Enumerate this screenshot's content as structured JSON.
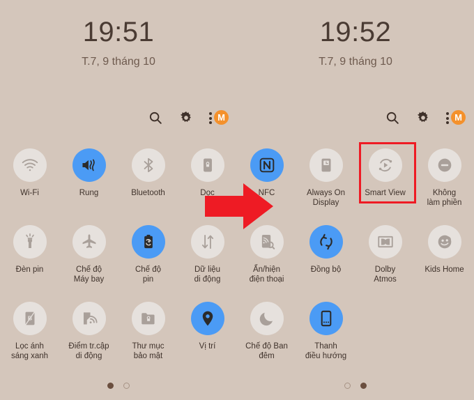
{
  "theme": {
    "background": "#d4c6bb",
    "tile_off": "#e6e1dd",
    "tile_on": "#4b9bf5",
    "accent_red": "#ee1b24",
    "badge_orange": "#f4912c",
    "text": "#3f322b"
  },
  "panels": [
    {
      "id": "left",
      "status": {
        "time": "19:51",
        "date": "T.7, 9 tháng 10"
      },
      "header_actions": [
        {
          "name": "search-icon",
          "label": "Tìm kiếm"
        },
        {
          "name": "gear-icon",
          "label": "Cài đặt"
        },
        {
          "name": "more-options-icon",
          "label": "M"
        }
      ],
      "account_badge": "M",
      "tiles": [
        {
          "label": "Wi-Fi",
          "icon": "wifi-icon",
          "on": false
        },
        {
          "label": "Rung",
          "icon": "vibrate-icon",
          "on": true
        },
        {
          "label": "Bluetooth",
          "icon": "bluetooth-icon",
          "on": false
        },
        {
          "label": "Dọc",
          "icon": "rotation-lock-icon",
          "on": false
        },
        {
          "label": "Đèn pin",
          "icon": "flashlight-icon",
          "on": false
        },
        {
          "label": "Chế độ\nMáy bay",
          "icon": "airplane-icon",
          "on": false
        },
        {
          "label": "Chế độ\npin",
          "icon": "power-saving-icon",
          "on": true
        },
        {
          "label": "Dữ liệu\ndi động",
          "icon": "mobile-data-icon",
          "on": false
        },
        {
          "label": "Lọc ánh\nsáng xanh",
          "icon": "blue-light-filter-icon",
          "on": false
        },
        {
          "label": "Điểm tr.cập\ndi động",
          "icon": "mobile-hotspot-icon",
          "on": false
        },
        {
          "label": "Thư mục\nbảo mật",
          "icon": "secure-folder-icon",
          "on": false
        },
        {
          "label": "Vị trí",
          "icon": "location-icon",
          "on": true
        }
      ],
      "page_dots": {
        "count": 2,
        "active": 0
      }
    },
    {
      "id": "right",
      "status": {
        "time": "19:52",
        "date": "T.7, 9 tháng 10"
      },
      "header_actions": [
        {
          "name": "search-icon",
          "label": "Tìm kiếm"
        },
        {
          "name": "gear-icon",
          "label": "Cài đặt"
        },
        {
          "name": "more-options-icon",
          "label": "M"
        }
      ],
      "account_badge": "M",
      "tiles": [
        {
          "label": "NFC",
          "icon": "nfc-icon",
          "on": true
        },
        {
          "label": "Always On\nDisplay",
          "icon": "always-on-display-icon",
          "on": false
        },
        {
          "label": "Smart View",
          "icon": "smart-view-icon",
          "on": false,
          "highlighted": true
        },
        {
          "label": "Không\nlàm phiền",
          "icon": "do-not-disturb-icon",
          "on": false
        },
        {
          "label": "Ẩn/hiện\nđiện thoại",
          "icon": "hide-phone-icon",
          "on": false
        },
        {
          "label": "Đồng bộ",
          "icon": "sync-icon",
          "on": true
        },
        {
          "label": "Dolby\nAtmos",
          "icon": "dolby-atmos-icon",
          "on": false
        },
        {
          "label": "Kids Home",
          "icon": "kids-home-icon",
          "on": false
        },
        {
          "label": "Chế độ Ban\nđêm",
          "icon": "night-mode-icon",
          "on": false
        },
        {
          "label": "Thanh\nđiều hướng",
          "icon": "navigation-bar-icon",
          "on": true
        },
        {
          "label": "",
          "icon": "",
          "on": false,
          "empty": true
        },
        {
          "label": "",
          "icon": "",
          "on": false,
          "empty": true
        }
      ],
      "page_dots": {
        "count": 2,
        "active": 1
      }
    }
  ],
  "annotations": {
    "arrow": {
      "name": "red-arrow-pointer",
      "color": "#ee1b24",
      "direction": "right"
    },
    "highlight_box": {
      "name": "smart-view-highlight",
      "color": "#ee1b24",
      "target": "Smart View"
    }
  }
}
